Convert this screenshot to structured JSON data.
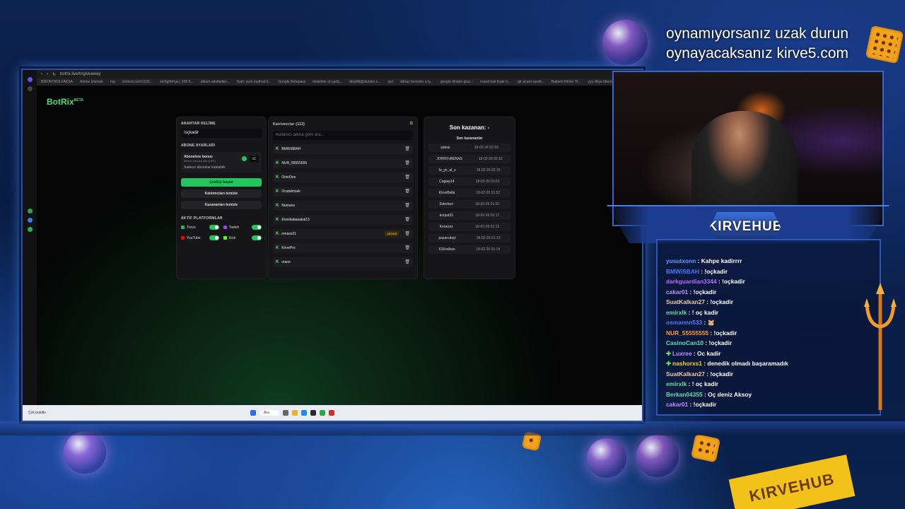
{
  "overlay": {
    "line1": "oynamıyorsanız uzak durun",
    "line2": "oynayacaksanız kirve5.com"
  },
  "browser": {
    "url": "botrix.live/tr/giveaway",
    "bookmarks": [
      "BİKONTROLFAKSA",
      "Anime İzlemek",
      "rsg",
      "zitotool.com/1193...",
      "ukr9gfdrFge | 206-5...",
      "albem adulteider...",
      "Sam: yurn method it...",
      "Google Notepass",
      "miskinler ün geliy...",
      "bbyb8l@dezvlor s...",
      "sg t",
      "kibrac herenler a ty...",
      "google dindon gkur...",
      "round tool fnale d...",
      "gtr at.ara sarıdi...",
      "Balperit filmler 'H...",
      "yyy ildiye bilerro"
    ]
  },
  "app": {
    "logo": "BotRix",
    "logo_badge": "BETA",
    "keyword_label": "ANAHTAR KELİME",
    "keyword_value": "!oçkadir",
    "sub_settings_label": "ABONE AYARLARI",
    "sub_bonus_title": "Abonelere bonus",
    "sub_bonus_desc": "Abone bonusu etki (OFF)",
    "sub_multiplier": "x1",
    "sub_only_label": "Sadece abonelar katılabilir",
    "start_button": "Çekilişi başlat",
    "clear_participants": "Katılımcıları temizle",
    "clear_winners": "Kazananları temizle",
    "platforms_label": "AKTİF PLATFORMLAR",
    "platforms": [
      "Trovo",
      "Twitch",
      "YouTube",
      "Kick"
    ],
    "participants_title": "Katılımcılar (112)",
    "search_placeholder": "Kullanıcı adına göre ara...",
    "participants": [
      {
        "name": "BMWiSBAH",
        "badge": ""
      },
      {
        "name": "NUR_55555555",
        "badge": ""
      },
      {
        "name": "OninOns",
        "badge": ""
      },
      {
        "name": "Ocatalmsek",
        "badge": ""
      },
      {
        "name": "Numans",
        "badge": ""
      },
      {
        "name": "Eneskabasakal13",
        "badge": ""
      },
      {
        "name": "renass21",
        "badge": "ABONE"
      },
      {
        "name": "KirvePro",
        "badge": ""
      },
      {
        "name": "vraox",
        "badge": ""
      }
    ],
    "winner_title": "Son kazanan: -",
    "winners_label": "Son kazananlar",
    "winners": [
      {
        "name": "yakvp",
        "time": "18-02-26 02:16"
      },
      {
        "name": "JOHNYsRENAS",
        "time": "18-02-26 02:15"
      },
      {
        "name": "fa_ye_al_s",
        "time": "18-02-26 02:15"
      },
      {
        "name": "Cagtay14",
        "time": "18-02-26 01:51"
      },
      {
        "name": "KirveBella",
        "time": "18-02-26 01:52"
      },
      {
        "name": "0sterben",
        "time": "18-02-26 01:51"
      },
      {
        "name": "korput31",
        "time": "18-02-26 01:17"
      },
      {
        "name": "Kerwzzz",
        "time": "18-02-26 01:13"
      },
      {
        "name": "pazarcdayi",
        "time": "18-02-26 01:13"
      },
      {
        "name": "616volkan",
        "time": "18-02-26 01:14"
      }
    ]
  },
  "taskbar": {
    "search": "Ara",
    "weather": "Çok bulutlu"
  },
  "brand": "KIRVEHUB",
  "chat": [
    {
      "user": "yusutxonn",
      "color": "#5aa0ff",
      "text": "Kahpe kadirrrr",
      "plus": false
    },
    {
      "user": "BMWiSBAH",
      "color": "#3f7bff",
      "text": "!oçkadir",
      "plus": false
    },
    {
      "user": "darkguardian3344",
      "color": "#b86cff",
      "text": "!oçkadir",
      "plus": false
    },
    {
      "user": "cakar01",
      "color": "#c58cff",
      "text": "!oçkadir",
      "plus": false
    },
    {
      "user": "SuatKalkan27",
      "color": "#f0c6a8",
      "text": "!oçkadir",
      "plus": false
    },
    {
      "user": "emirxlk",
      "color": "#5be0a0",
      "text": "! oç kadir",
      "plus": false
    },
    {
      "user": "osmannn533",
      "color": "#4f7cff",
      "text": "🐹",
      "plus": false
    },
    {
      "user": "NUR_55555555",
      "color": "#ff9a3c",
      "text": "!oçkadir",
      "plus": false
    },
    {
      "user": "CasinoCan10",
      "color": "#5be0c0",
      "text": "!oçkadir",
      "plus": false
    },
    {
      "user": "Luxree",
      "color": "#c58cff",
      "text": "Oc kadir",
      "plus": true
    },
    {
      "user": "nashorxs1",
      "color": "#ffd21f",
      "text": "denedik olmadı başaramadık",
      "plus": true
    },
    {
      "user": "SuatKalkan27",
      "color": "#f0c6a8",
      "text": "!oçkadir",
      "plus": false
    },
    {
      "user": "emirxlk",
      "color": "#5be0a0",
      "text": "! oç kadir",
      "plus": false
    },
    {
      "user": "Berkan04355",
      "color": "#5be0a0",
      "text": "Oç deniz Aksoy",
      "plus": false
    },
    {
      "user": "cakar01",
      "color": "#c58cff",
      "text": "!oçkadir",
      "plus": false
    }
  ]
}
